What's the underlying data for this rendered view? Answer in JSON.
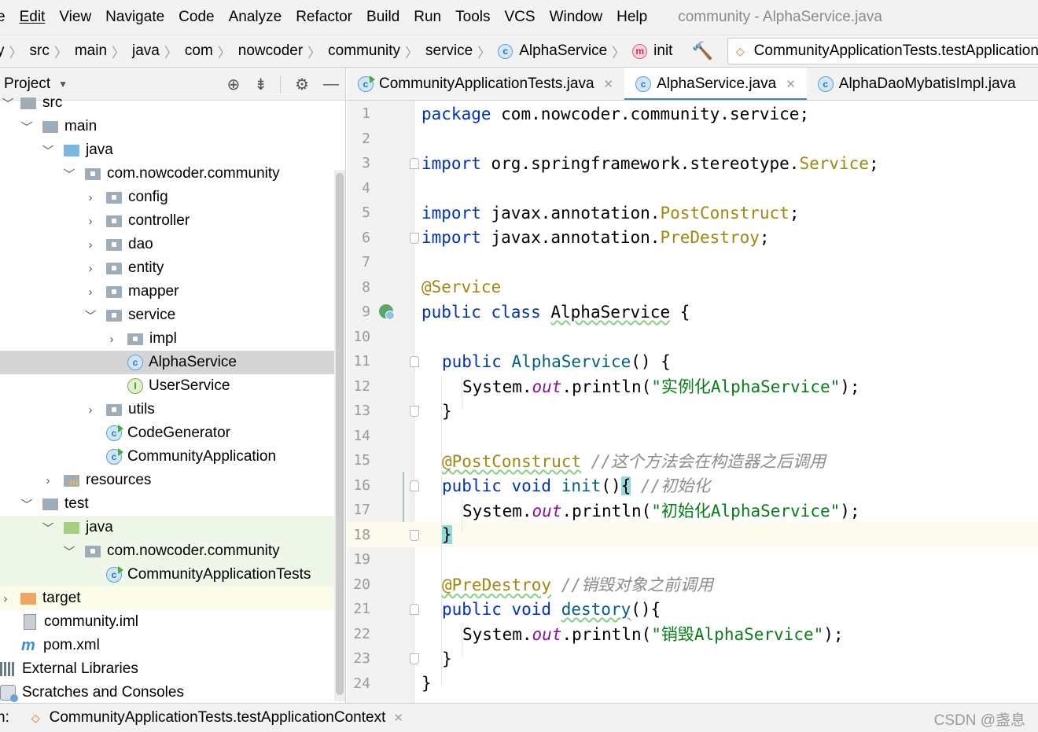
{
  "menubar": {
    "items": [
      "e",
      "Edit",
      "View",
      "Navigate",
      "Code",
      "Analyze",
      "Refactor",
      "Build",
      "Run",
      "Tools",
      "VCS",
      "Window",
      "Help"
    ],
    "window_title": "community - AlphaService.java"
  },
  "navbar": {
    "crumbs": [
      "y",
      "src",
      "main",
      "java",
      "com",
      "nowcoder",
      "community",
      "service"
    ],
    "class_crumb": "AlphaService",
    "method_crumb": "init",
    "run_config": "CommunityApplicationTests.testApplicationCon"
  },
  "project": {
    "title": "Project",
    "tree": [
      {
        "label": "src",
        "icon": "folder"
      },
      {
        "label": "main",
        "icon": "folder"
      },
      {
        "label": "java",
        "icon": "folder-blue"
      },
      {
        "label": "com.nowcoder.community",
        "icon": "package"
      },
      {
        "label": "config",
        "icon": "package"
      },
      {
        "label": "controller",
        "icon": "package"
      },
      {
        "label": "dao",
        "icon": "package"
      },
      {
        "label": "entity",
        "icon": "package"
      },
      {
        "label": "mapper",
        "icon": "package"
      },
      {
        "label": "service",
        "icon": "package"
      },
      {
        "label": "impl",
        "icon": "package"
      },
      {
        "label": "AlphaService",
        "icon": "class"
      },
      {
        "label": "UserService",
        "icon": "interface"
      },
      {
        "label": "utils",
        "icon": "package"
      },
      {
        "label": "CodeGenerator",
        "icon": "class-runnable"
      },
      {
        "label": "CommunityApplication",
        "icon": "class-runnable"
      },
      {
        "label": "resources",
        "icon": "folder-resources"
      },
      {
        "label": "test",
        "icon": "folder"
      },
      {
        "label": "java",
        "icon": "folder-green"
      },
      {
        "label": "com.nowcoder.community",
        "icon": "package"
      },
      {
        "label": "CommunityApplicationTests",
        "icon": "class-runnable"
      },
      {
        "label": "target",
        "icon": "folder-orange"
      },
      {
        "label": "community.iml",
        "icon": "iml-file"
      },
      {
        "label": "pom.xml",
        "icon": "maven-file"
      },
      {
        "label": "External Libraries",
        "icon": "libraries"
      },
      {
        "label": "Scratches and Consoles",
        "icon": "scratches"
      }
    ]
  },
  "editor": {
    "tabs": [
      {
        "label": "CommunityApplicationTests.java",
        "active": false
      },
      {
        "label": "AlphaService.java",
        "active": true
      },
      {
        "label": "AlphaDaoMybatisImpl.java",
        "active": false
      }
    ],
    "line_numbers": [
      "1",
      "2",
      "3",
      "4",
      "5",
      "6",
      "7",
      "8",
      "9",
      "10",
      "11",
      "12",
      "13",
      "14",
      "15",
      "16",
      "17",
      "18",
      "19",
      "20",
      "21",
      "22",
      "23",
      "24"
    ],
    "code": {
      "l1_kw": "package",
      "l1_rest": " com.nowcoder.community.service;",
      "l3_kw": "import",
      "l3_pkg": " org.springframework.stereotype.",
      "l3_cls": "Service",
      "l3_end": ";",
      "l5_kw": "import",
      "l5_pkg": " javax.annotation.",
      "l5_cls": "PostConstruct",
      "l5_end": ";",
      "l6_kw": "import",
      "l6_pkg": " javax.annotation.",
      "l6_cls": "PreDestroy",
      "l6_end": ";",
      "l8_ann": "@Service",
      "l9_kw": "public class",
      "l9_name": "AlphaService",
      "l9_end": " {",
      "l11_kw": "public",
      "l11_fn": "AlphaService",
      "l11_end": "() {",
      "l12_a": "System.",
      "l12_fld": "out",
      "l12_b": ".println(",
      "l12_str": "\"实例化AlphaService\"",
      "l12_c": ");",
      "l13": "}",
      "l15_ann": "@PostConstruct",
      "l15_cmt": " //这个方法会在构造器之后调用",
      "l16_kw": "public void",
      "l16_fn": "init",
      "l16_paren": "()",
      "l16_brace": "{",
      "l16_cmt": " //初始化",
      "l17_a": "System.",
      "l17_fld": "out",
      "l17_b": ".println(",
      "l17_str": "\"初始化AlphaService\"",
      "l17_c": ");",
      "l18": "}",
      "l20_ann": "@PreDestroy",
      "l20_cmt": " //销毁对象之前调用",
      "l21_kw": "public void",
      "l21_fn": "destory",
      "l21_end": "(){",
      "l22_a": "System.",
      "l22_fld": "out",
      "l22_b": ".println(",
      "l22_str": "\"销毁AlphaService\"",
      "l22_c": ");",
      "l23": "}",
      "l24": "}"
    }
  },
  "bottombar": {
    "label": "n:",
    "run_tab": "CommunityApplicationTests.testApplicationContext",
    "watermark": "CSDN @盏息"
  },
  "colors": {
    "keyword": "#0033b3",
    "annotation": "#9e880d",
    "string": "#067d17",
    "comment": "#8c8c8c",
    "field": "#871094",
    "method": "#00627a",
    "tab_underline": "#4083c9",
    "selection": "#d5d5d5"
  }
}
